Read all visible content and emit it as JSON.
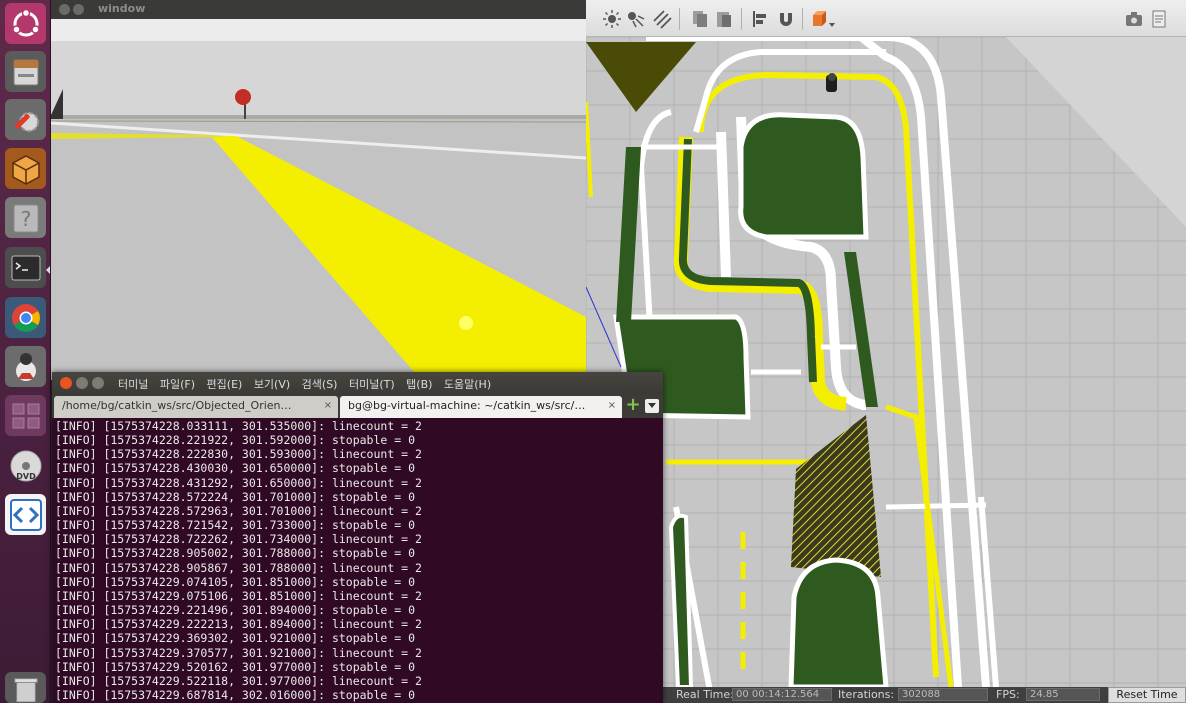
{
  "camera_window": {
    "title": "window"
  },
  "launcher": {
    "items": [
      {
        "name": "dash-home-icon"
      },
      {
        "name": "files-icon"
      },
      {
        "name": "system-settings-icon"
      },
      {
        "name": "gazebo-icon"
      },
      {
        "name": "help-icon"
      },
      {
        "name": "terminal-icon"
      },
      {
        "name": "chrome-icon"
      },
      {
        "name": "java-app-icon"
      },
      {
        "name": "workspace-switcher-icon"
      },
      {
        "name": "dvd-icon"
      },
      {
        "name": "code-editor-icon"
      },
      {
        "name": "trash-icon"
      }
    ]
  },
  "terminal": {
    "menu": [
      "터미널",
      "파일(F)",
      "편집(E)",
      "보기(V)",
      "검색(S)",
      "터미널(T)",
      "탭(B)",
      "도움말(H)"
    ],
    "tabs": [
      {
        "label": "/home/bg/catkin_ws/src/Objected_Orien…",
        "close": "×"
      },
      {
        "label": "bg@bg-virtual-machine: ~/catkin_ws/src/…",
        "close": "×"
      }
    ],
    "lines": [
      "[INFO] [1575374228.033111, 301.535000]: linecount = 2",
      "[INFO] [1575374228.221922, 301.592000]: stopable = 0",
      "[INFO] [1575374228.222830, 301.593000]: linecount = 2",
      "[INFO] [1575374228.430030, 301.650000]: stopable = 0",
      "[INFO] [1575374228.431292, 301.650000]: linecount = 2",
      "[INFO] [1575374228.572224, 301.701000]: stopable = 0",
      "[INFO] [1575374228.572963, 301.701000]: linecount = 2",
      "[INFO] [1575374228.721542, 301.733000]: stopable = 0",
      "[INFO] [1575374228.722262, 301.734000]: linecount = 2",
      "[INFO] [1575374228.905002, 301.788000]: stopable = 0",
      "[INFO] [1575374228.905867, 301.788000]: linecount = 2",
      "[INFO] [1575374229.074105, 301.851000]: stopable = 0",
      "[INFO] [1575374229.075106, 301.851000]: linecount = 2",
      "[INFO] [1575374229.221496, 301.894000]: stopable = 0",
      "[INFO] [1575374229.222213, 301.894000]: linecount = 2",
      "[INFO] [1575374229.369302, 301.921000]: stopable = 0",
      "[INFO] [1575374229.370577, 301.921000]: linecount = 2",
      "[INFO] [1575374229.520162, 301.977000]: stopable = 0",
      "[INFO] [1575374229.522118, 301.977000]: linecount = 2",
      "[INFO] [1575374229.687814, 302.016000]: stopable = 0"
    ]
  },
  "gazebo": {
    "toolbar": [
      {
        "name": "sun-light-icon"
      },
      {
        "name": "spot-light-icon"
      },
      {
        "name": "directional-light-icon"
      },
      {
        "name": "copy-icon"
      },
      {
        "name": "paste-icon"
      },
      {
        "name": "align-icon"
      },
      {
        "name": "snap-icon"
      },
      {
        "name": "view-angle-icon"
      },
      {
        "name": "screenshot-icon"
      },
      {
        "name": "log-icon"
      }
    ],
    "status": {
      "real_time_label": "Real Time:",
      "real_time_value": "00 00:14:12.564",
      "iterations_label": "Iterations:",
      "iterations_value": "302088",
      "fps_label": "FPS:",
      "fps_value": "24.85",
      "reset_label": "Reset Time"
    }
  },
  "colors": {
    "launcher_bg": "#4a2140",
    "terminal_bg": "#300a24",
    "track_yellow": "#f4ee00",
    "grass_green": "#2f5a1f",
    "road_grey": "#c2c2c2"
  }
}
